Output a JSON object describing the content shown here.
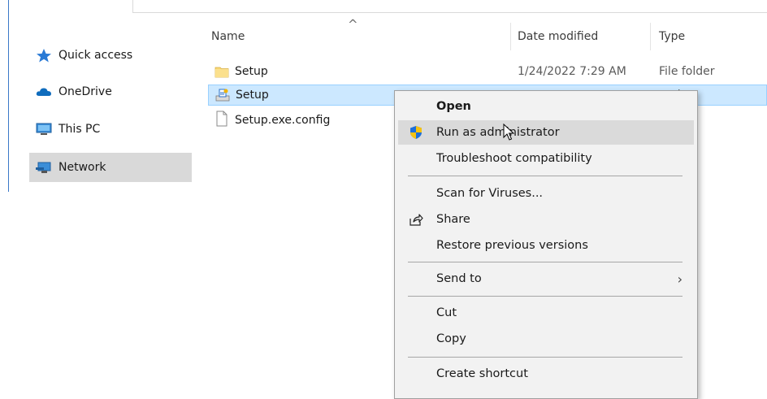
{
  "nav": {
    "items": [
      {
        "label": "Quick access",
        "icon": "star-icon"
      },
      {
        "label": "OneDrive",
        "icon": "cloud-icon"
      },
      {
        "label": "This PC",
        "icon": "monitor-icon"
      },
      {
        "label": "Network",
        "icon": "network-icon",
        "selected": true
      }
    ]
  },
  "columns": {
    "name": "Name",
    "date": "Date modified",
    "type": "Type",
    "sort_indicator": "^"
  },
  "files": [
    {
      "name": "Setup",
      "date": "1/24/2022 7:29 AM",
      "type": "File folder",
      "icon": "folder-icon"
    },
    {
      "name": "Setup",
      "date": "",
      "type": "cation",
      "icon": "installer-icon",
      "selected": true
    },
    {
      "name": "Setup.exe.config",
      "date": "",
      "type": "IG File",
      "icon": "document-icon"
    }
  ],
  "context_menu": {
    "open": "Open",
    "run_as_admin": "Run as administrator",
    "troubleshoot": "Troubleshoot compatibility",
    "scan": "Scan for Viruses...",
    "share": "Share",
    "restore": "Restore previous versions",
    "send_to": "Send to",
    "send_to_chevron": "›",
    "cut": "Cut",
    "copy": "Copy",
    "create_shortcut": "Create shortcut"
  },
  "colors": {
    "selection_bg": "#cce8ff",
    "menu_bg": "#f2f2f2",
    "menu_hover": "#dadada",
    "nav_selected": "#d9d9d9",
    "accent": "#3a78c8"
  }
}
